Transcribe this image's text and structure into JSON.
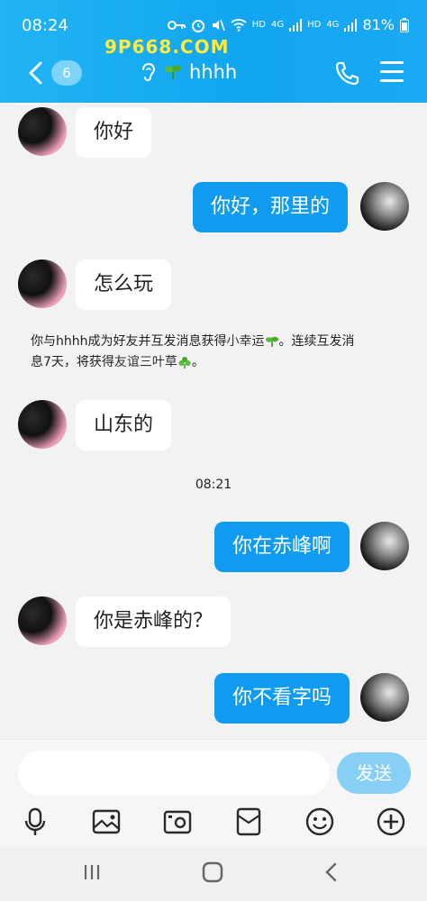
{
  "status_bar": {
    "time": "08:24",
    "hd1": "HD",
    "net1": "4G",
    "hd2": "HD",
    "net2": "4G",
    "battery": "81%"
  },
  "watermark": "9P668.COM",
  "header": {
    "unread_count": "6",
    "contact_name": "hhhh"
  },
  "messages": [
    {
      "side": "in",
      "text": "你好"
    },
    {
      "side": "out",
      "text": "你好，那里的"
    },
    {
      "side": "in",
      "text": "怎么玩"
    },
    {
      "side": "in",
      "text": "山东的"
    },
    {
      "side": "out",
      "text": "你在赤峰啊"
    },
    {
      "side": "in",
      "text": "你是赤峰的？"
    },
    {
      "side": "out",
      "text": "你不看字吗"
    }
  ],
  "system_notice": {
    "line1_a": "你与hhhh成为好友并互发消息获得",
    "line1_b": "小幸运",
    "line1_c": "。连续互发消",
    "line2_a": "息7天，将获得",
    "line2_b": "友谊三叶草",
    "line2_c": "。"
  },
  "timestamp": "08:21",
  "input": {
    "placeholder": "",
    "send_label": "发送"
  },
  "colors": {
    "header_bg": "#1aa9f2",
    "bubble_out": "#0f9cf0",
    "send_button": "#88cff5"
  },
  "icons": {
    "back": "chevron-left-icon",
    "phone": "phone-icon",
    "menu": "menu-icon",
    "ear": "ear-icon",
    "sprout": "sprout-icon",
    "mic": "mic-icon",
    "image": "image-icon",
    "camera": "camera-icon",
    "red_packet": "red-packet-icon",
    "emoji": "emoji-icon",
    "plus": "plus-icon",
    "recents": "recent-apps-icon",
    "home": "home-icon",
    "back_nav": "back-nav-icon"
  }
}
